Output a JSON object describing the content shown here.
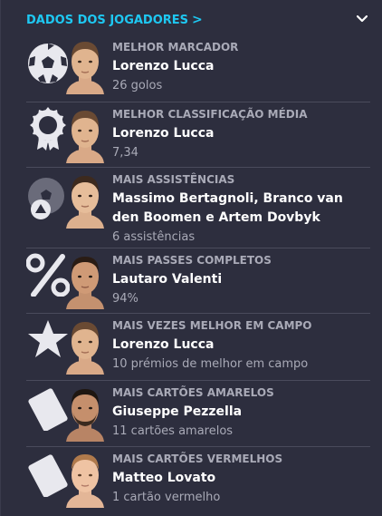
{
  "header": {
    "title": "DADOS DOS JOGADORES",
    "chevron": ">"
  },
  "rows": [
    {
      "category": "MELHOR MARCADOR",
      "name": "Lorenzo Lucca",
      "stat": "26 golos",
      "icon": "football-icon",
      "skin": "#e0b48f",
      "hair": "#6a4a33"
    },
    {
      "category": "MELHOR CLASSIFICAÇÃO MÉDIA",
      "name": "Lorenzo Lucca",
      "stat": "7,34",
      "icon": "rating-medal-icon",
      "skin": "#e0b48f",
      "hair": "#6a4a33"
    },
    {
      "category": "MAIS ASSISTÊNCIAS",
      "name": "Massimo Bertagnoli, Branco van den Boomen e Artem Dovbyk",
      "stat": "6 assistências",
      "icon": "football-assist-icon",
      "skin": "#e6bd9a",
      "hair": "#3d2a1e"
    },
    {
      "category": "MAIS PASSES COMPLETOS",
      "name": "Lautaro Valenti",
      "stat": "94%",
      "icon": "percent-icon",
      "skin": "#cf9a76",
      "hair": "#2a1c14"
    },
    {
      "category": "MAIS VEZES MELHOR EM CAMPO",
      "name": "Lorenzo Lucca",
      "stat": "10 prémios de melhor em campo",
      "icon": "star-icon",
      "skin": "#e0b48f",
      "hair": "#6a4a33"
    },
    {
      "category": "MAIS CARTÕES AMARELOS",
      "name": "Giuseppe Pezzella",
      "stat": "11 cartões amarelos",
      "icon": "yellow-card-icon",
      "skin": "#c58f6c",
      "hair": "#1e1611"
    },
    {
      "category": "MAIS CARTÕES VERMELHOS",
      "name": "Matteo Lovato",
      "stat": "1 cartão vermelho",
      "icon": "red-card-icon",
      "skin": "#efc3a3",
      "hair": "#b07a4c"
    }
  ]
}
